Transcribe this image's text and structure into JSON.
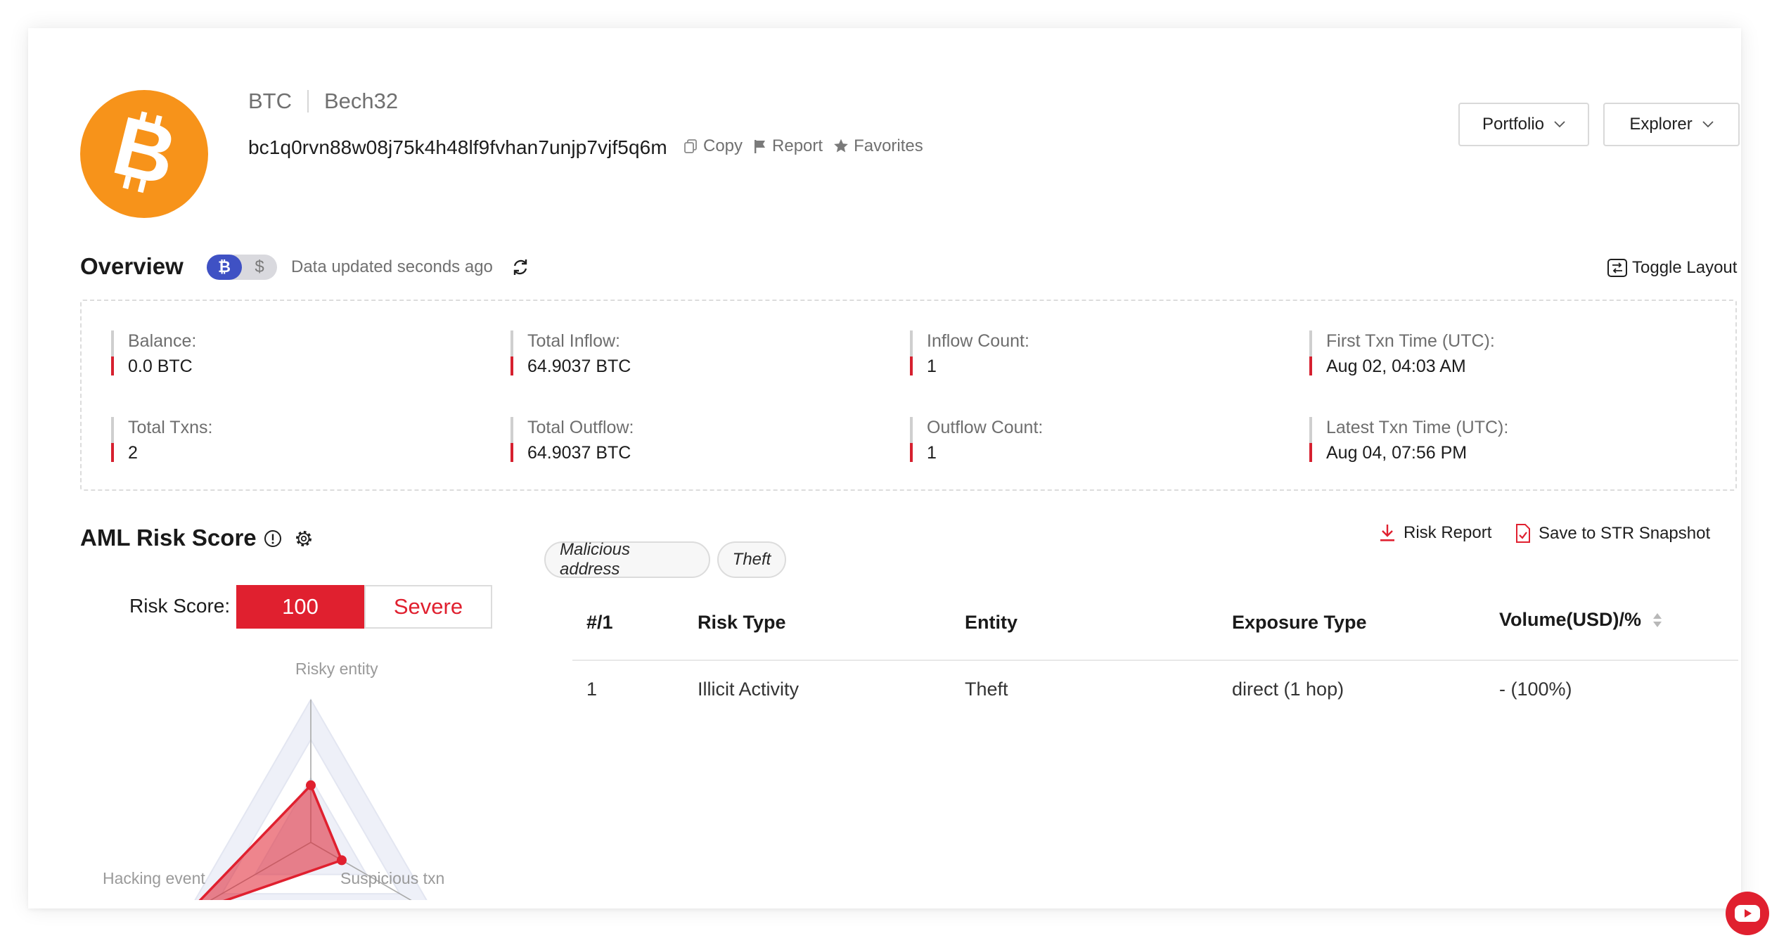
{
  "header": {
    "coin": "BTC",
    "address_type": "Bech32",
    "address": "bc1q0rvn88w08j75k4h48lf9fvhan7unjp7vjf5q6m",
    "actions": {
      "copy": "Copy",
      "report": "Report",
      "favorites": "Favorites"
    },
    "portfolio_label": "Portfolio",
    "explorer_label": "Explorer"
  },
  "overview": {
    "title": "Overview",
    "currency_toggle": {
      "btc_symbol": "₿",
      "usd_symbol": "$",
      "selected": "BTC"
    },
    "updated_text": "Data updated seconds ago",
    "toggle_layout_label": "Toggle Layout",
    "stats": [
      {
        "label": "Balance:",
        "value": "0.0 BTC"
      },
      {
        "label": "Total Inflow:",
        "value": "64.9037 BTC"
      },
      {
        "label": "Inflow Count:",
        "value": "1"
      },
      {
        "label": "First Txn Time (UTC):",
        "value": "Aug 02, 04:03 AM"
      },
      {
        "label": "Total Txns:",
        "value": "2"
      },
      {
        "label": "Total Outflow:",
        "value": "64.9037 BTC"
      },
      {
        "label": "Outflow Count:",
        "value": "1"
      },
      {
        "label": "Latest Txn Time (UTC):",
        "value": "Aug 04, 07:56 PM"
      }
    ]
  },
  "aml": {
    "title": "AML Risk Score",
    "score_label": "Risk Score:",
    "score_value": "100",
    "severity": "Severe",
    "radar": {
      "axes": [
        "Risky entity",
        "Suspicious txn",
        "Hacking event"
      ],
      "values": [
        0.4,
        0.25,
        1.0
      ]
    },
    "tags": [
      "Malicious address",
      "Theft"
    ],
    "risk_report_label": "Risk Report",
    "save_label": "Save to STR Snapshot",
    "table": {
      "headers": [
        "#/1",
        "Risk Type",
        "Entity",
        "Exposure Type",
        "Volume(USD)/%"
      ],
      "rows": [
        [
          "1",
          "Illicit Activity",
          "Theft",
          "direct (1 hop)",
          "- (100%)"
        ]
      ]
    }
  },
  "colors": {
    "accent": "#e0202f",
    "bitcoin": "#f7931a",
    "toggle_active": "#3f51c4"
  }
}
